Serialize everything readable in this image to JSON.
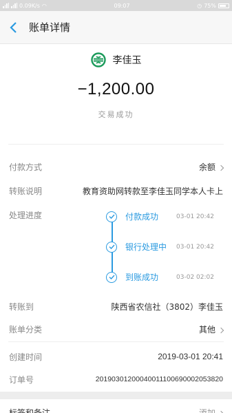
{
  "status_bar": {
    "speed": "0.09K/s",
    "time": "09:07",
    "battery": "75%"
  },
  "nav": {
    "title": "账单详情"
  },
  "header": {
    "name": "李佳玉",
    "amount": "−1,200.00",
    "status": "交易成功"
  },
  "rows": {
    "pay_method": {
      "label": "付款方式",
      "value": "余额"
    },
    "note": {
      "label": "转账说明",
      "value": "教育资助网转款至李佳玉同学本人卡上"
    },
    "progress": {
      "label": "处理进度",
      "steps": [
        {
          "name": "付款成功",
          "time": "03-01 20:42"
        },
        {
          "name": "银行处理中",
          "time": "03-01 20:42"
        },
        {
          "name": "到账成功",
          "time": "03-02 02:02"
        }
      ]
    },
    "to": {
      "label": "转账到",
      "value": "陕西省农信社（3802）李佳玉"
    },
    "category": {
      "label": "账单分类",
      "value": "其他"
    },
    "created": {
      "label": "创建时间",
      "value": "2019-03-01 20:41"
    },
    "order": {
      "label": "订单号",
      "value": "20190301200040011100690002053820"
    }
  },
  "tags": {
    "label": "标签和备注",
    "value": "添加"
  },
  "colors": {
    "accent": "#2a9ae0",
    "logo": "#1a9a5a"
  }
}
